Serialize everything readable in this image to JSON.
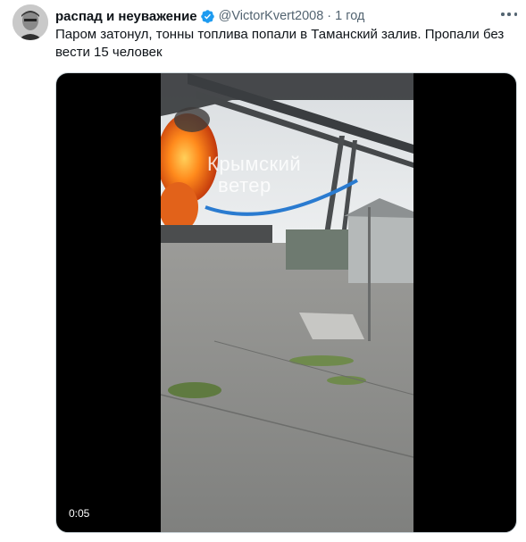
{
  "tweet": {
    "display_name": "распад и неуважение",
    "handle": "@VictorKvert2008",
    "separator": "·",
    "time": "1 год",
    "text": "Паром затонул, тонны топлива попали в Таманский залив. Пропали без вести 15 человек",
    "verified_icon": "verified-badge-icon",
    "more_icon": "more-options-icon",
    "accent_color": "#1d9bf0"
  },
  "video": {
    "timestamp": "0:05",
    "watermark_line1": "Крымский",
    "watermark_line2": "ветер"
  }
}
